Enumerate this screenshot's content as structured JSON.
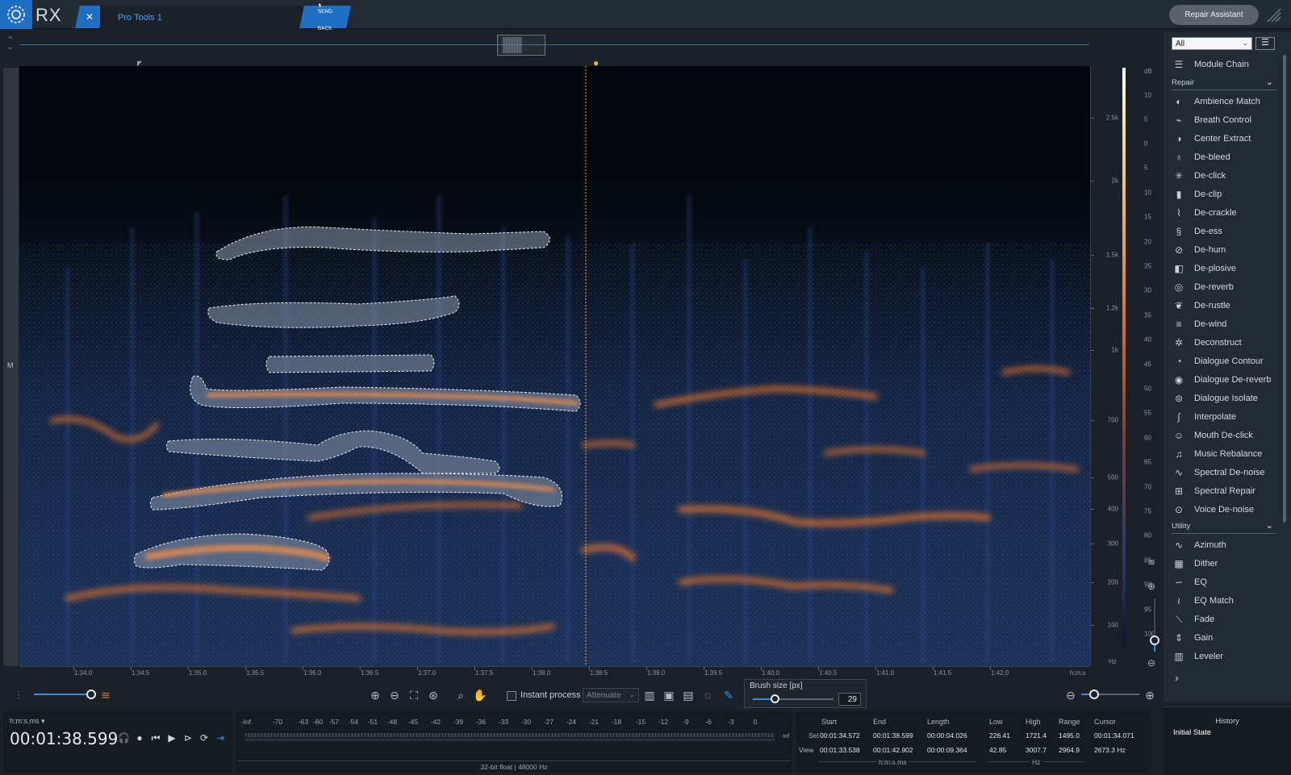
{
  "app": {
    "name": "RX",
    "tab_title": "Pro Tools 1",
    "send_back_line1": "SEND",
    "send_back_line2": "BACK",
    "repair_assistant": "Repair Assistant"
  },
  "spectrogram": {
    "channel_label": "M",
    "hz_labels": [
      "2.5k",
      "2k",
      "1.5k",
      "1.2k",
      "1k",
      "700",
      "500",
      "400",
      "300",
      "200",
      "100"
    ],
    "hz_unit": "Hz",
    "db_unit": "dB",
    "db_labels": [
      "10",
      "5",
      "0",
      "5",
      "10",
      "15",
      "20",
      "25",
      "30",
      "35",
      "40",
      "45",
      "50",
      "55",
      "60",
      "65",
      "70",
      "75",
      "80",
      "85",
      "90",
      "95",
      "100"
    ],
    "time_labels": [
      "1:34.0",
      "1:34.5",
      "1:35.0",
      "1:35.5",
      "1:36.0",
      "1:36.5",
      "1:37.0",
      "1:37.5",
      "1:38.0",
      "1:38.5",
      "1:39.0",
      "1:39.5",
      "1:40.0",
      "1:40.5",
      "1:41.0",
      "1:41.5",
      "1:42.0"
    ],
    "time_unit": "h:m:s"
  },
  "toolbar": {
    "instant_process": "Instant process",
    "mode": "Attenuate",
    "brush_size_label": "Brush size [px]",
    "brush_size_value": "29"
  },
  "transport": {
    "time_format": "h:m:s.ms",
    "time": "00:01:38.599"
  },
  "meter": {
    "scale": [
      "-Inf.",
      "-70",
      "-63",
      "-60",
      "-57",
      "-54",
      "-51",
      "-48",
      "-45",
      "-42",
      "-39",
      "-36",
      "-33",
      "-30",
      "-27",
      "-24",
      "-21",
      "-18",
      "-15",
      "-12",
      "-9",
      "-6",
      "-3",
      "0"
    ],
    "inf_label": "-Inf",
    "format": "32-bit float | 48000 Hz"
  },
  "selection": {
    "headers": {
      "start": "Start",
      "end": "End",
      "length": "Length",
      "low": "Low",
      "high": "High",
      "range": "Range",
      "cursor": "Cursor"
    },
    "sel_label": "Sel",
    "view_label": "View",
    "sel": {
      "start": "00:01:34.572",
      "end": "00:01:38.599",
      "length": "00:00:04.026",
      "low": "226.41",
      "high": "1721.4",
      "range": "1495.0",
      "cursor": "00:01:34.071"
    },
    "view": {
      "start": "00:01:33.538",
      "end": "00:01:42.902",
      "length": "00:00:09.364",
      "low": "42.85",
      "high": "3007.7",
      "range": "2964.9",
      "cursor": "2673.3 Hz"
    },
    "time_unit": "h:m:s.ms",
    "freq_unit": "Hz"
  },
  "modules": {
    "filter": "All",
    "module_chain": "Module Chain",
    "repair_header": "Repair",
    "repair": [
      "Ambience Match",
      "Breath Control",
      "Center Extract",
      "De-bleed",
      "De-click",
      "De-clip",
      "De-crackle",
      "De-ess",
      "De-hum",
      "De-plosive",
      "De-reverb",
      "De-rustle",
      "De-wind",
      "Deconstruct",
      "Dialogue Contour",
      "Dialogue De-reverb",
      "Dialogue Isolate",
      "Interpolate",
      "Mouth De-click",
      "Music Rebalance",
      "Spectral De-noise",
      "Spectral Repair",
      "Voice De-noise"
    ],
    "utility_header": "Utility",
    "utility": [
      "Azimuth",
      "Dither",
      "EQ",
      "EQ Match",
      "Fade",
      "Gain",
      "Leveler"
    ]
  },
  "history": {
    "title": "History",
    "items": [
      "Initial State"
    ]
  },
  "colors": {
    "accent": "#1f6fc4",
    "playhead": "#f2b43a",
    "spectrum_hot": "#e07a35",
    "spectrum_cool": "#2b4a8a"
  }
}
